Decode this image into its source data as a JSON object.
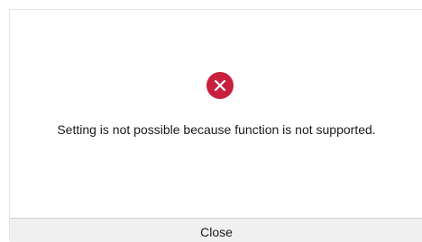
{
  "dialog": {
    "icon": "error-icon",
    "message": "Setting is not possible because function is not supported.",
    "close_label": "Close"
  },
  "colors": {
    "error": "#c8203d",
    "button_bg": "#f0f0f0"
  }
}
